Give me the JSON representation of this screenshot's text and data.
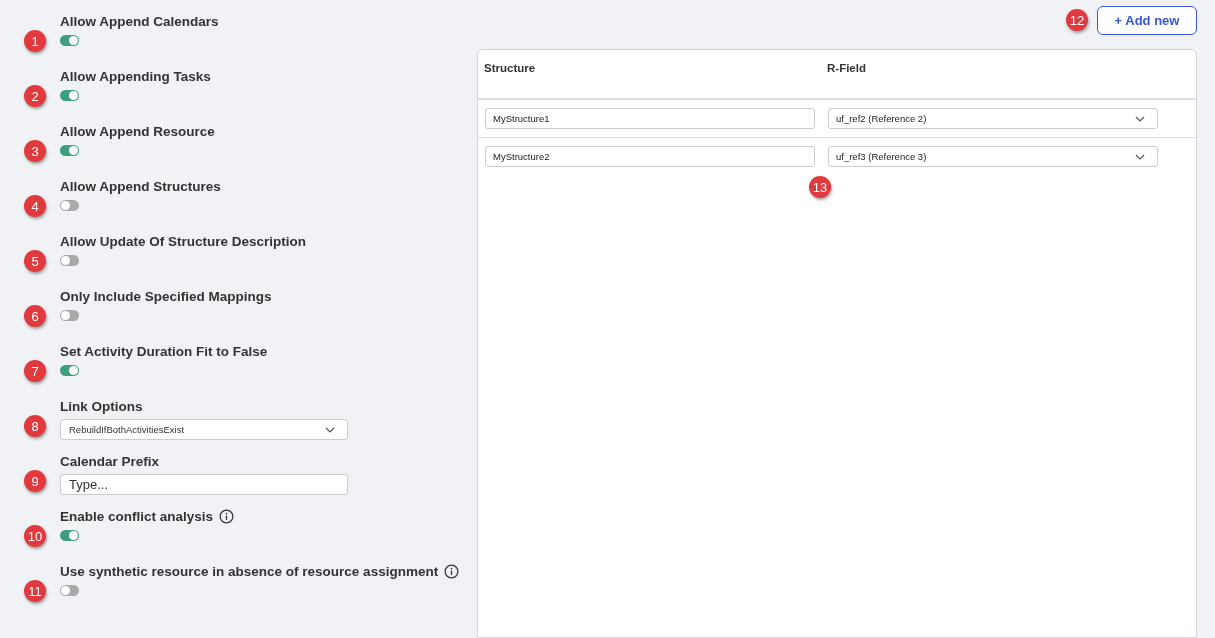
{
  "settings": [
    {
      "kind": "toggle",
      "marker": "1",
      "label": "Allow Append Calendars",
      "on": true,
      "info": false
    },
    {
      "kind": "toggle",
      "marker": "2",
      "label": "Allow Appending Tasks",
      "on": true,
      "info": false
    },
    {
      "kind": "toggle",
      "marker": "3",
      "label": "Allow Append Resource",
      "on": true,
      "info": false
    },
    {
      "kind": "toggle",
      "marker": "4",
      "label": "Allow Append Structures",
      "on": false,
      "info": false
    },
    {
      "kind": "toggle",
      "marker": "5",
      "label": "Allow Update Of Structure Description",
      "on": false,
      "info": false
    },
    {
      "kind": "toggle",
      "marker": "6",
      "label": "Only Include Specified Mappings",
      "on": false,
      "info": false
    },
    {
      "kind": "toggle",
      "marker": "7",
      "label": "Set Activity Duration Fit to False",
      "on": true,
      "info": false
    },
    {
      "kind": "select",
      "marker": "8",
      "label": "Link Options",
      "value": "RebuildIfBothActivitiesExist"
    },
    {
      "kind": "text",
      "marker": "9",
      "label": "Calendar Prefix",
      "placeholder": "Type..."
    },
    {
      "kind": "toggle",
      "marker": "10",
      "label": "Enable conflict analysis",
      "on": true,
      "info": true
    },
    {
      "kind": "toggle",
      "marker": "11",
      "label": "Use synthetic resource in absence of resource assignment",
      "on": false,
      "info": true
    }
  ],
  "add_button": {
    "label": "+ Add new",
    "marker": "12"
  },
  "table": {
    "marker": "13",
    "columns": [
      "Structure",
      "R-Field"
    ],
    "rows": [
      {
        "structure": "MyStructure1",
        "r_field": "uf_ref2 (Reference 2)"
      },
      {
        "structure": "MyStructure2",
        "r_field": "uf_ref3 (Reference 3)"
      }
    ]
  }
}
